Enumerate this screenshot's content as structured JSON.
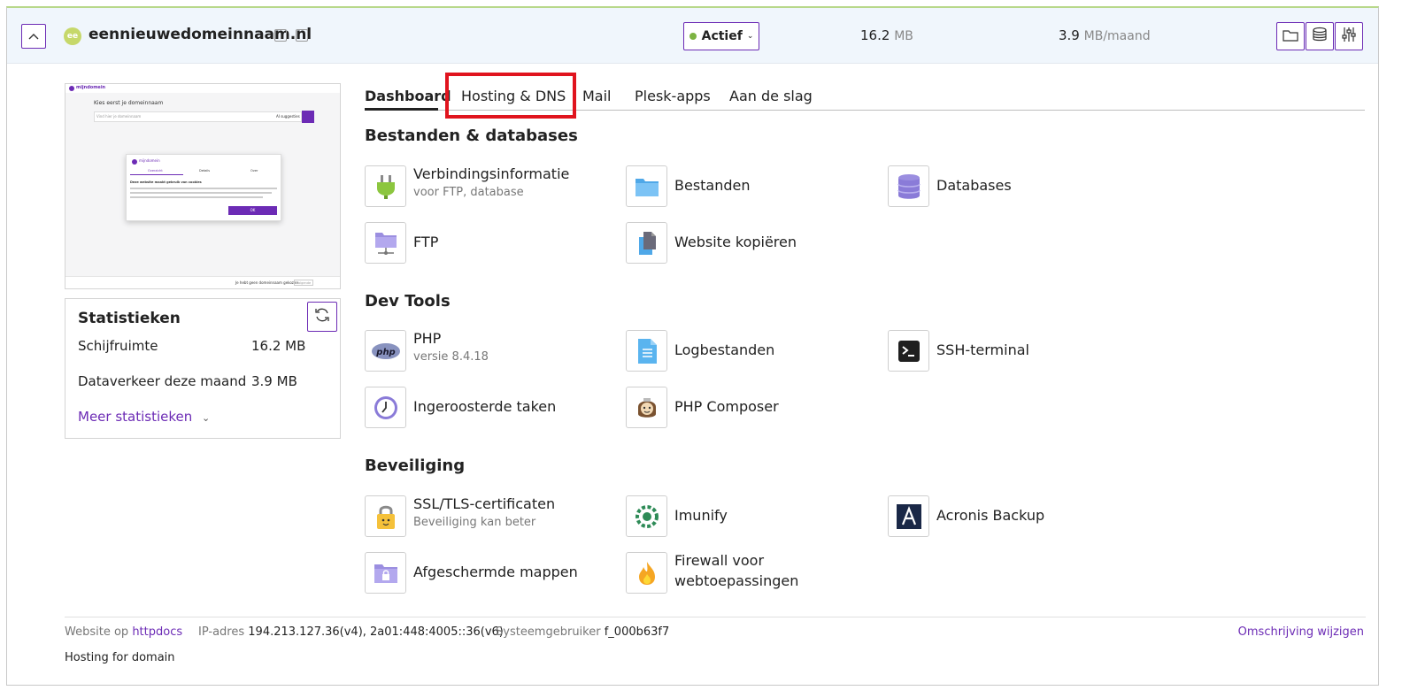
{
  "header": {
    "domain_badge": "ee",
    "domain_name": "eennieuwedomeinnaam.nl",
    "status": "Actief",
    "status_color": "#7cb342",
    "disk_value": "16.2",
    "disk_unit": "MB",
    "traffic_value": "3.9",
    "traffic_unit": "MB/maand",
    "icons": [
      "copy-icon",
      "external-link-icon",
      "folder-icon",
      "database-icon",
      "settings-sliders-icon"
    ]
  },
  "preview": {
    "brand": "mijndomein",
    "heading": "Kies eerst je domeinnaam",
    "search_placeholder": "Vind hier je domeinnaam",
    "checkbox_label": "AI suggesties",
    "cookie_brand": "mijndomein",
    "cookie_tabs": [
      "Overzicht",
      "Details",
      "Over"
    ],
    "cookie_title": "Deze website maakt gebruik van cookies",
    "cookie_ok": "OK",
    "footer_text": "Je hebt geen domeinnaam gekozen",
    "footer_button": "Volgende"
  },
  "stats": {
    "title": "Statistieken",
    "rows": [
      {
        "label": "Schijfruimte",
        "value": "16.2 MB"
      },
      {
        "label": "Dataverkeer deze maand",
        "value": "3.9 MB"
      }
    ],
    "more": "Meer statistieken"
  },
  "tabs": [
    {
      "label": "Dashboard",
      "active": true
    },
    {
      "label": "Hosting & DNS",
      "active": false
    },
    {
      "label": "Mail",
      "active": false
    },
    {
      "label": "Plesk-apps",
      "active": false
    },
    {
      "label": "Aan de slag",
      "active": false
    }
  ],
  "highlight_color": "#e0141e",
  "sections": {
    "files": {
      "title": "Bestanden & databases",
      "tiles": [
        {
          "label": "Verbindingsinformatie",
          "sub": "voor FTP, database",
          "icon": "plug-icon"
        },
        {
          "label": "Bestanden",
          "icon": "folder-icon"
        },
        {
          "label": "Databases",
          "icon": "database-icon"
        },
        {
          "label": "FTP",
          "icon": "ftp-folder-icon"
        },
        {
          "label": "Website kopiëren",
          "icon": "copy-files-icon"
        }
      ]
    },
    "dev": {
      "title": "Dev Tools",
      "tiles": [
        {
          "label": "PHP",
          "sub": "versie 8.4.18",
          "icon": "php-icon"
        },
        {
          "label": "Logbestanden",
          "icon": "log-file-icon"
        },
        {
          "label": "SSH-terminal",
          "icon": "terminal-icon"
        },
        {
          "label": "Ingeroosterde taken",
          "icon": "clock-icon"
        },
        {
          "label": "PHP Composer",
          "icon": "composer-icon"
        }
      ]
    },
    "security": {
      "title": "Beveiliging",
      "tiles": [
        {
          "label": "SSL/TLS-certificaten",
          "sub": "Beveiliging kan beter",
          "icon": "lock-icon"
        },
        {
          "label": "Imunify",
          "icon": "imunify-icon"
        },
        {
          "label": "Acronis Backup",
          "icon": "acronis-icon"
        },
        {
          "label": "Afgeschermde mappen",
          "icon": "protected-folder-icon"
        },
        {
          "label": "Firewall voor",
          "label2": "webtoepassingen",
          "icon": "flame-icon"
        }
      ]
    }
  },
  "footer": {
    "website_label": "Website op",
    "website_link": "httpdocs",
    "ip_label": "IP-adres",
    "ip_value": "194.213.127.36(v4), 2a01:448:4005::36(v6)",
    "user_label": "Systeemgebruiker",
    "user_value": "f_000b63f7",
    "description_link": "Omschrijving wijzigen",
    "hosting_for": "Hosting for domain"
  },
  "colors": {
    "accent": "#6c2bb5",
    "header_bg": "#f0f6fc"
  }
}
